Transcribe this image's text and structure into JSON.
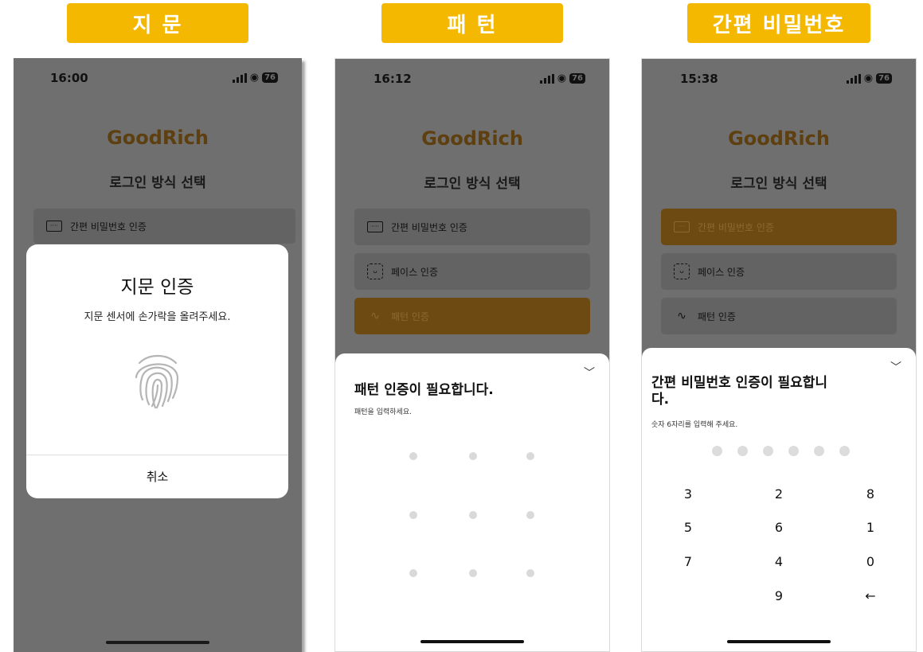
{
  "columns": [
    {
      "label": "지 문"
    },
    {
      "label": "패  턴"
    },
    {
      "label": "간편 비밀번호"
    }
  ],
  "phones": [
    {
      "time": "16:00",
      "battery": "76"
    },
    {
      "time": "16:12",
      "battery": "76"
    },
    {
      "time": "15:38",
      "battery": "76"
    }
  ],
  "app": {
    "logo": "GoodRich",
    "title": "로그인 방식 선택"
  },
  "options": {
    "pin": "간편 비밀번호 인증",
    "face": "페이스 인증",
    "pattern": "패턴 인증"
  },
  "fingerprint_dialog": {
    "title": "지문 인증",
    "subtitle": "지문 센서에 손가락을 올려주세요.",
    "cancel": "취소"
  },
  "pattern_sheet": {
    "title": "패턴 인증이 필요합니다.",
    "subtitle": "패턴을 입력하세요."
  },
  "pin_sheet": {
    "title": "간편 비밀번호 인증이 필요합니다.",
    "subtitle": "숫자 6자리를 입력해 주세요.",
    "keys": [
      "3",
      "2",
      "8",
      "5",
      "6",
      "1",
      "7",
      "4",
      "0",
      "9",
      "←"
    ]
  },
  "colors": {
    "label_bg": "#f5b800",
    "brand": "#5e3f10",
    "selected_option": "#6d4a12",
    "overlay": "#6f6f6f"
  }
}
